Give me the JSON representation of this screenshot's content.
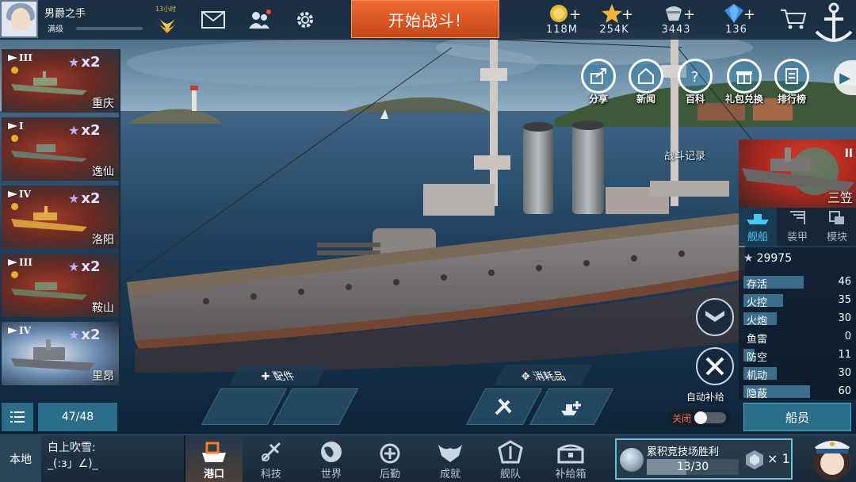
{
  "player": {
    "name": "男爵之手",
    "level": "满级",
    "medal_label": "13小时"
  },
  "top": {
    "battle_button": "开始战斗!"
  },
  "resources": [
    {
      "name": "gold",
      "icon": "gold-coin-icon",
      "value": "118M"
    },
    {
      "name": "star",
      "icon": "star-icon",
      "value": "254K"
    },
    {
      "name": "fuel",
      "icon": "fuel-icon",
      "value": "3443"
    },
    {
      "name": "diamond",
      "icon": "diamond-icon",
      "value": "136"
    }
  ],
  "ships": [
    {
      "tier": "III",
      "mult": "x2",
      "name": "重庆"
    },
    {
      "tier": "I",
      "mult": "x2",
      "name": "逸仙"
    },
    {
      "tier": "IV",
      "mult": "x2",
      "name": "洛阳"
    },
    {
      "tier": "III",
      "mult": "x2",
      "name": "鞍山"
    },
    {
      "tier": "IV",
      "mult": "x2",
      "name": "里昂"
    }
  ],
  "list": {
    "count": "47/48"
  },
  "shortcuts": [
    {
      "icon": "share-icon",
      "label": "分享"
    },
    {
      "icon": "news-icon",
      "label": "新闻"
    },
    {
      "icon": "wiki-icon",
      "label": "百科"
    },
    {
      "icon": "gift-icon",
      "label": "礼包兑换"
    },
    {
      "icon": "ranking-icon",
      "label": "排行榜"
    }
  ],
  "battle_record": "战斗记录",
  "selected_ship": {
    "name": "三笠",
    "power": "29975"
  },
  "right_tabs": [
    {
      "icon": "ship-icon",
      "label": "舰船",
      "active": true
    },
    {
      "icon": "armor-icon",
      "label": "装甲",
      "active": false
    },
    {
      "icon": "module-icon",
      "label": "模块",
      "active": false
    }
  ],
  "stats": [
    {
      "label": "存活",
      "value": 46
    },
    {
      "label": "火控",
      "value": 35
    },
    {
      "label": "火炮",
      "value": 30
    },
    {
      "label": "鱼雷",
      "value": 0
    },
    {
      "label": "防空",
      "value": 11
    },
    {
      "label": "机动",
      "value": 30
    },
    {
      "label": "隐蔽",
      "value": 60
    }
  ],
  "crew_button": "船员",
  "equip": {
    "parts_label": "配件",
    "consumables_label": "消耗品"
  },
  "auto_supply": {
    "label": "自动补给",
    "state_label": "关闭"
  },
  "bottom": {
    "local_label": "本地",
    "chat_user": "白上吹雪:",
    "chat_text": "_(:з」∠)_",
    "nav": [
      {
        "icon": "port-icon",
        "label": "港口",
        "active": true
      },
      {
        "icon": "tech-icon",
        "label": "科技",
        "active": false
      },
      {
        "icon": "world-icon",
        "label": "世界",
        "active": false
      },
      {
        "icon": "logistics-icon",
        "label": "后勤",
        "active": false
      },
      {
        "icon": "achievement-icon",
        "label": "成就",
        "active": false
      },
      {
        "icon": "fleet-icon",
        "label": "舰队",
        "active": false
      },
      {
        "icon": "supply-box-icon",
        "label": "补给箱",
        "active": false
      }
    ],
    "arena": {
      "label": "累积竞技场胜利",
      "progress": "13/30",
      "progress_fraction": 0.433,
      "reward": "× 1"
    }
  },
  "colors": {
    "accent": "#2c6e88",
    "battle": "#e05a24",
    "active_tab": "#48c8f0"
  }
}
